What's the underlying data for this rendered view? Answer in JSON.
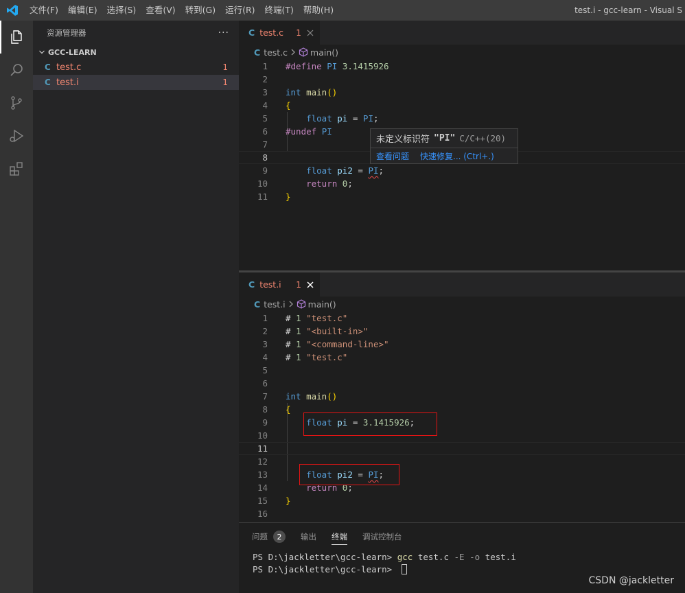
{
  "titlebar": {
    "menu": [
      "文件(F)",
      "编辑(E)",
      "选择(S)",
      "查看(V)",
      "转到(G)",
      "运行(R)",
      "终端(T)",
      "帮助(H)"
    ],
    "window_title": "test.i - gcc-learn - Visual S"
  },
  "activity": [
    "explorer-icon",
    "search-icon",
    "source-control-icon",
    "run-debug-icon",
    "extensions-icon"
  ],
  "sidebar": {
    "title": "资源管理器",
    "more": "···",
    "folder": "GCC-LEARN",
    "files": [
      {
        "name": "test.c",
        "count": "1"
      },
      {
        "name": "test.i",
        "count": "1"
      }
    ]
  },
  "editor1": {
    "tab": {
      "icon": "C",
      "name": "test.c",
      "count": "1"
    },
    "breadcrumb": {
      "file": "test.c",
      "symbol": "main()"
    },
    "line_numbers": [
      "1",
      "2",
      "3",
      "4",
      "5",
      "6",
      "7",
      "8",
      "9",
      "10",
      "11"
    ],
    "code": {
      "l1_pre": "#define",
      "l1_name": "PI",
      "l1_val": "3.1415926",
      "l3_type": "int",
      "l3_fn": "main",
      "l3_paren": "()",
      "brace_open": "{",
      "l5_type": "float",
      "l5_var": "pi",
      "l5_eq": " = ",
      "l5_mac": "PI",
      "semi": ";",
      "l6_pre": "#undef",
      "l6_name": "PI",
      "l9_type": "float",
      "l9_var": "pi2",
      "l9_eq": " = ",
      "l9_mac": "PI",
      "l10_ret": "return",
      "l10_num": "0",
      "brace_close": "}"
    },
    "hover": {
      "message": "未定义标识符",
      "identifier": "\"PI\"",
      "source": "C/C++(20)",
      "action_view": "查看问题",
      "action_fix": "快速修复... (Ctrl+.)"
    }
  },
  "editor2": {
    "tab": {
      "icon": "C",
      "name": "test.i",
      "count": "1"
    },
    "breadcrumb": {
      "file": "test.i",
      "symbol": "main()"
    },
    "line_numbers": [
      "1",
      "2",
      "3",
      "4",
      "5",
      "6",
      "7",
      "8",
      "9",
      "10",
      "11",
      "12",
      "13",
      "14",
      "15",
      "16"
    ],
    "code": {
      "hash": "#",
      "one": "1",
      "s1": "\"test.c\"",
      "s2": "\"<built-in>\"",
      "s3": "\"<command-line>\"",
      "s4": "\"test.c\"",
      "l7_type": "int",
      "l7_fn": "main",
      "l7_paren": "()",
      "brace_open": "{",
      "l9_type": "float",
      "l9_var": "pi",
      "l9_eq": " = ",
      "l9_num": "3.1415926",
      "semi": ";",
      "l13_type": "float",
      "l13_var": "pi2",
      "l13_eq": " = ",
      "l13_mac": "PI",
      "l14_ret": "return",
      "l14_num": "0",
      "brace_close": "}"
    }
  },
  "panel": {
    "tabs": [
      "问题",
      "输出",
      "终端",
      "调试控制台"
    ],
    "problems_count": "2",
    "terminal": {
      "prompt1": "PS D:\\jackletter\\gcc-learn> ",
      "cmd": "gcc",
      "args1": " test.c ",
      "flag1": "-E",
      "space": " ",
      "flag2": "-o",
      "args2": " test.i",
      "prompt2": "PS D:\\jackletter\\gcc-learn> "
    }
  },
  "watermark": "CSDN @jackletter"
}
